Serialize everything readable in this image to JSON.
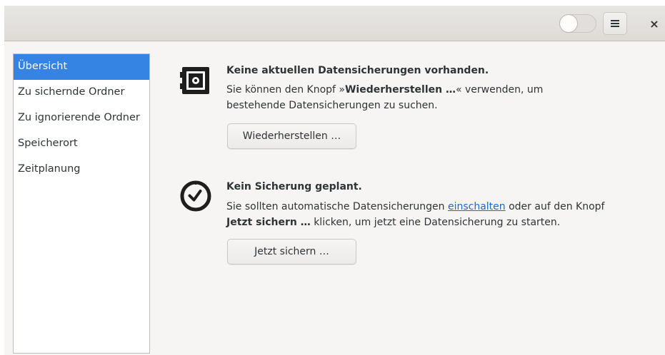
{
  "headerbar": {
    "toggle": {
      "state": "off"
    },
    "menu_icon": "hamburger-menu-icon",
    "close_label": "×"
  },
  "sidebar": {
    "items": [
      {
        "label": "Übersicht",
        "selected": true
      },
      {
        "label": "Zu sichernde Ordner"
      },
      {
        "label": "Zu ignorierende Ordner"
      },
      {
        "label": "Speicherort"
      },
      {
        "label": "Zeitplanung"
      }
    ]
  },
  "overview": {
    "restore": {
      "icon": "safe-icon",
      "title": "Keine aktuellen Datensicherungen vorhanden.",
      "line1_pre": "Sie können den Knopf »",
      "line1_bold": "Wiederherstellen …",
      "line1_post": "« verwenden, um",
      "line2": "bestehende Datensicherungen zu suchen.",
      "button_label": "Wiederherstellen …"
    },
    "schedule": {
      "icon": "clock-icon",
      "title": "Kein Sicherung geplant.",
      "line1_pre": "Sie sollten automatische Datensicherungen ",
      "line1_link": "einschalten",
      "line1_post": " oder auf den Knopf",
      "line2_bold": "Jetzt sichern …",
      "line2_post": " klicken, um jetzt eine Datensicherung zu starten.",
      "button_label": "Jetzt sichern …"
    }
  },
  "colors": {
    "accent": "#3584e4",
    "link": "#1b6acb",
    "text": "#2e3436"
  }
}
